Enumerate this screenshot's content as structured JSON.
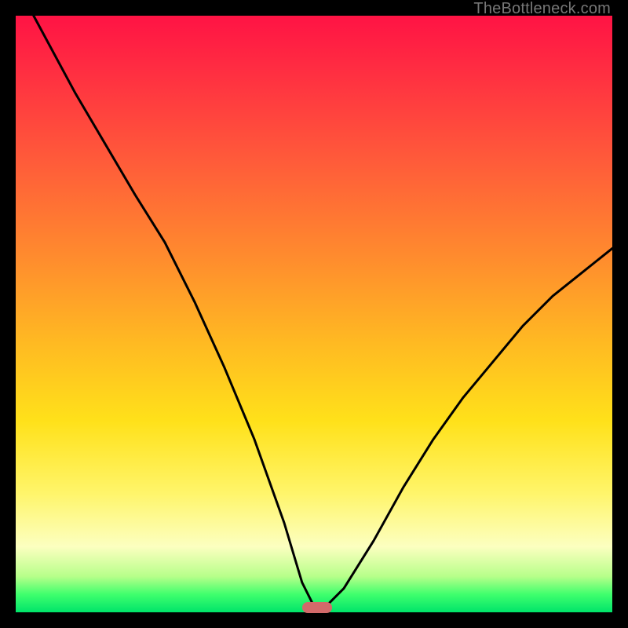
{
  "watermark": "TheBottleneck.com",
  "chart_data": {
    "type": "line",
    "title": "",
    "xlabel": "",
    "ylabel": "",
    "xlim": [
      0,
      100
    ],
    "ylim": [
      0,
      100
    ],
    "grid": false,
    "legend": false,
    "series": [
      {
        "name": "bottleneck-curve",
        "x": [
          3,
          10,
          20,
          25,
          30,
          35,
          40,
          45,
          48,
          50,
          52,
          55,
          60,
          65,
          70,
          75,
          80,
          85,
          90,
          95,
          100
        ],
        "y": [
          100,
          87,
          70,
          62,
          52,
          41,
          29,
          15,
          5,
          1,
          1,
          4,
          12,
          21,
          29,
          36,
          42,
          48,
          53,
          57,
          61
        ]
      }
    ],
    "marker": {
      "x": 50.5,
      "y": 0.8
    },
    "background_gradient": {
      "top": "#ff1344",
      "mid_upper": "#ff8a2e",
      "mid": "#ffe11a",
      "mid_lower": "#fcffc0",
      "bottom": "#00e46a"
    }
  }
}
